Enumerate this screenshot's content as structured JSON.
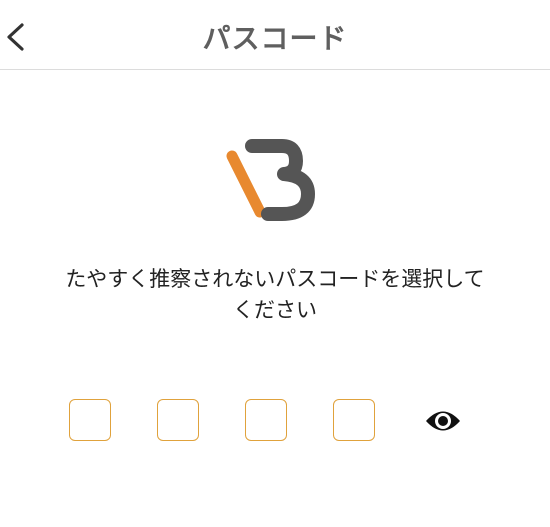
{
  "header": {
    "title": "パスコード",
    "back_icon": "chevron-left-icon"
  },
  "logo": {
    "icon": "brand-logo-icon",
    "colors": {
      "accent": "#e8892f",
      "main": "#555555"
    }
  },
  "instruction": {
    "line1": "たやすく推察されないパスコードを選択して",
    "line2": "ください"
  },
  "passcode": {
    "digits": [
      "",
      "",
      "",
      ""
    ],
    "border_color": "#e0a23c",
    "visibility_icon": "eye-icon"
  }
}
